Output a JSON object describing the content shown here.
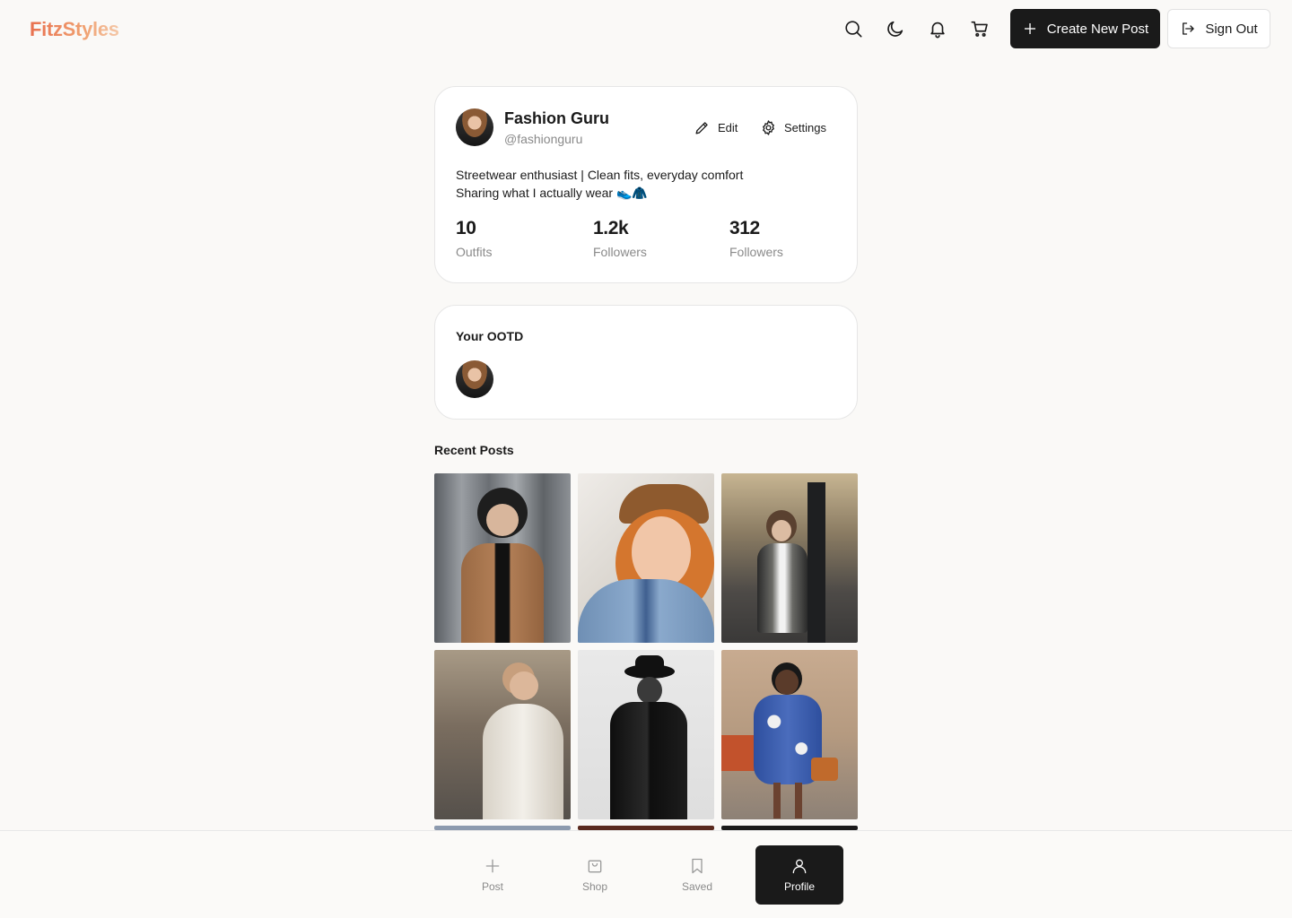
{
  "header": {
    "logo": "FitzStyles",
    "icons": [
      "search-icon",
      "moon-icon",
      "bell-icon",
      "cart-icon"
    ],
    "create_label": "Create New Post",
    "signout_label": "Sign Out"
  },
  "profile": {
    "name": "Fashion Guru",
    "handle": "@fashionguru",
    "edit_label": "Edit",
    "settings_label": "Settings",
    "bio_line1": "Streetwear enthusiast | Clean fits, everyday comfort",
    "bio_line2": "Sharing what I actually wear 👟🧥",
    "stats": [
      {
        "value": "10",
        "label": "Outfits"
      },
      {
        "value": "1.2k",
        "label": "Followers"
      },
      {
        "value": "312",
        "label": "Followers"
      }
    ]
  },
  "ootd": {
    "title": "Your OOTD"
  },
  "recent": {
    "title": "Recent Posts",
    "posts": [
      {
        "name": "post-brown-coat-hat",
        "bg": "#8e9196",
        "accent": "#a8754e"
      },
      {
        "name": "post-orange-hair-beret",
        "bg": "#e8e4df",
        "accent": "#8e5a2e"
      },
      {
        "name": "post-grey-coat-street",
        "bg": "#6d6a66",
        "accent": "#7a7670"
      },
      {
        "name": "post-white-puffer-cap",
        "bg": "#7d746a",
        "accent": "#ebe6de"
      },
      {
        "name": "post-black-coat-hat",
        "bg": "#e6e6e6",
        "accent": "#1c1c1c"
      },
      {
        "name": "post-blue-dress-bag",
        "bg": "#b8a08a",
        "accent": "#2e4f9e"
      }
    ]
  },
  "bottom_nav": {
    "items": [
      {
        "label": "Post",
        "icon": "plus-icon"
      },
      {
        "label": "Shop",
        "icon": "shopping-bag-icon"
      },
      {
        "label": "Saved",
        "icon": "bookmark-icon"
      },
      {
        "label": "Profile",
        "icon": "user-icon",
        "active": true
      }
    ]
  }
}
